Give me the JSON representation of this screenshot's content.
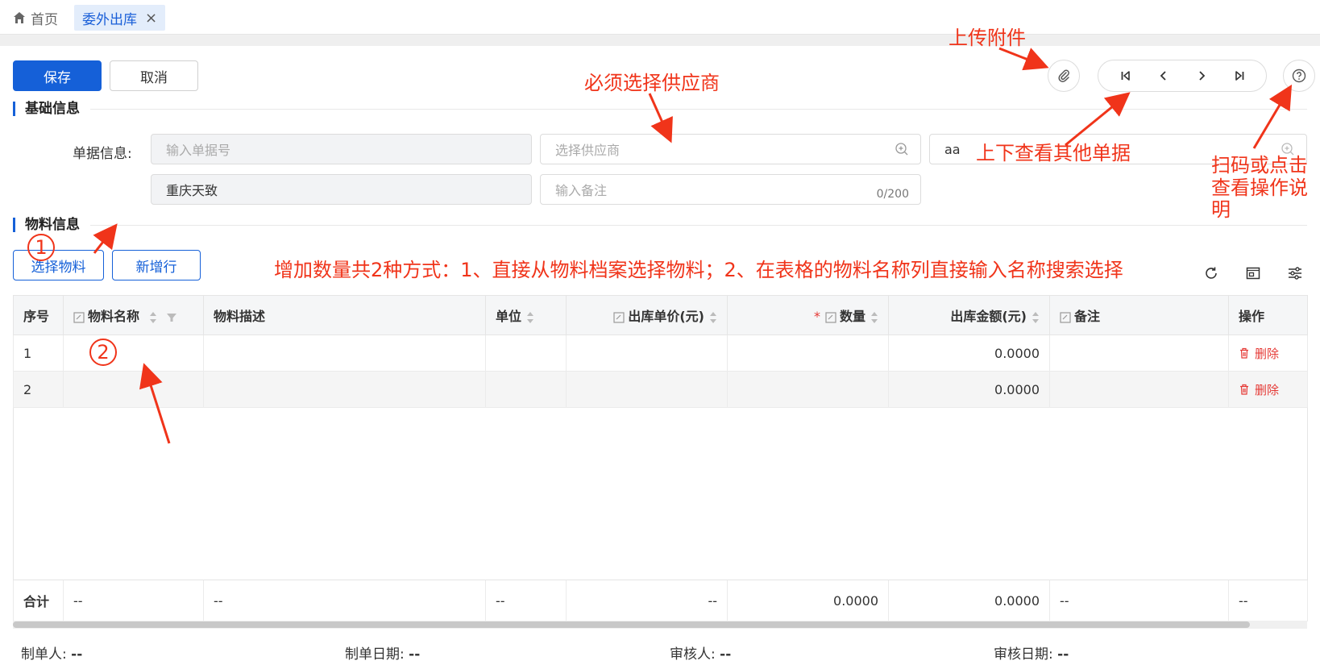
{
  "tabs": {
    "home_label": "首页",
    "active_label": "委外出库",
    "close_glyph": "×"
  },
  "toolbar": {
    "save_label": "保存",
    "cancel_label": "取消"
  },
  "sections": {
    "basic": "基础信息",
    "material": "物料信息"
  },
  "form": {
    "doc_info_label": "单据信息:",
    "doc_no_placeholder": "输入单据号",
    "supplier_placeholder": "选择供应商",
    "third_value": "aa",
    "company_value": "重庆天致",
    "remark_placeholder": "输入备注",
    "remark_counter": "0/200"
  },
  "material_actions": {
    "select_label": "选择物料",
    "add_row_label": "新增行"
  },
  "table": {
    "headers": [
      "序号",
      "物料名称",
      "物料描述",
      "单位",
      "出库单价(元)",
      "数量",
      "出库金额(元)",
      "备注",
      "操作"
    ],
    "rows": [
      {
        "seq": "1",
        "amount": "0.0000",
        "action": "删除"
      },
      {
        "seq": "2",
        "amount": "0.0000",
        "action": "删除"
      }
    ],
    "total": {
      "label": "合计",
      "name": "--",
      "desc": "--",
      "unit": "--",
      "price": "--",
      "qty": "0.0000",
      "amount": "0.0000",
      "remark": "--",
      "action": "--"
    }
  },
  "footer": {
    "creator_label": "制单人:",
    "creator_value": "--",
    "create_date_label": "制单日期:",
    "create_date_value": "--",
    "reviewer_label": "审核人:",
    "reviewer_value": "--",
    "review_date_label": "审核日期:",
    "review_date_value": "--"
  },
  "annotations": {
    "upload": "上传附件",
    "supplier": "必须选择供应商",
    "browse": "上下查看其他单据",
    "help": "扫码或点击查看操作说明",
    "add_methods": "增加数量共2种方式：1、直接从物料档案选择物料；2、在表格的物料名称列直接输入名称搜索选择",
    "num1": "①",
    "num2": "②"
  },
  "colors": {
    "primary": "#1560d8",
    "annotation": "#f0341a",
    "danger": "#e53935"
  },
  "icons": [
    "home-icon",
    "close-icon",
    "paperclip-icon",
    "first-page-icon",
    "prev-icon",
    "next-icon",
    "last-page-icon",
    "help-icon",
    "search-plus-icon",
    "refresh-icon",
    "fullscreen-icon",
    "settings-icon",
    "sort-icon",
    "filter-icon",
    "edit-icon",
    "trash-icon"
  ]
}
